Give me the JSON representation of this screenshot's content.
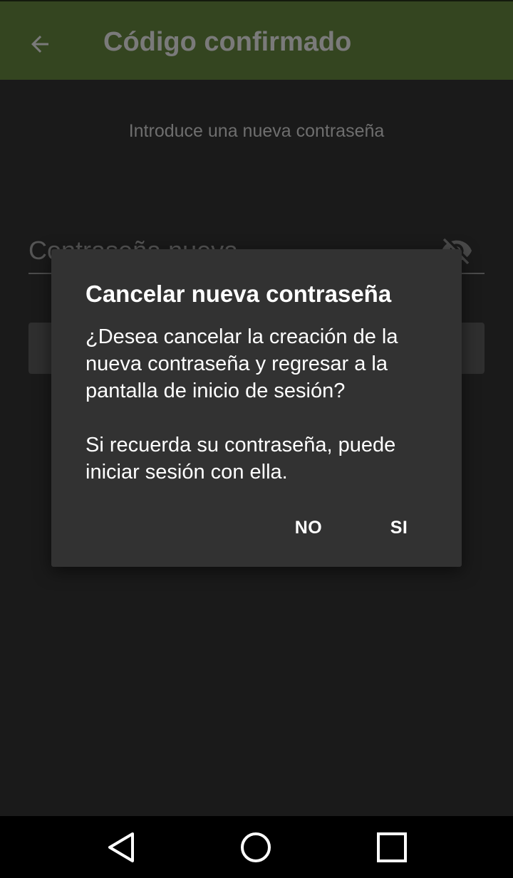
{
  "app_bar": {
    "title": "Código confirmado",
    "back_icon": "arrow-left-icon",
    "background": "#344520"
  },
  "form": {
    "subtitle": "Introduce una nueva contraseña",
    "password_placeholder": "Contraseña nueva",
    "visibility_icon": "eye-off-icon"
  },
  "dialog": {
    "title": "Cancelar nueva contraseña",
    "message_1": "¿Desea cancelar la creación de la nueva contraseña y regresar a la pantalla de inicio de sesión?",
    "message_2": "Si recuerda su contraseña, puede iniciar sesión con ella.",
    "no_label": "NO",
    "yes_label": "SI"
  },
  "nav_bar": {
    "back_icon": "triangle-back-icon",
    "home_icon": "circle-home-icon",
    "recents_icon": "square-recents-icon"
  }
}
